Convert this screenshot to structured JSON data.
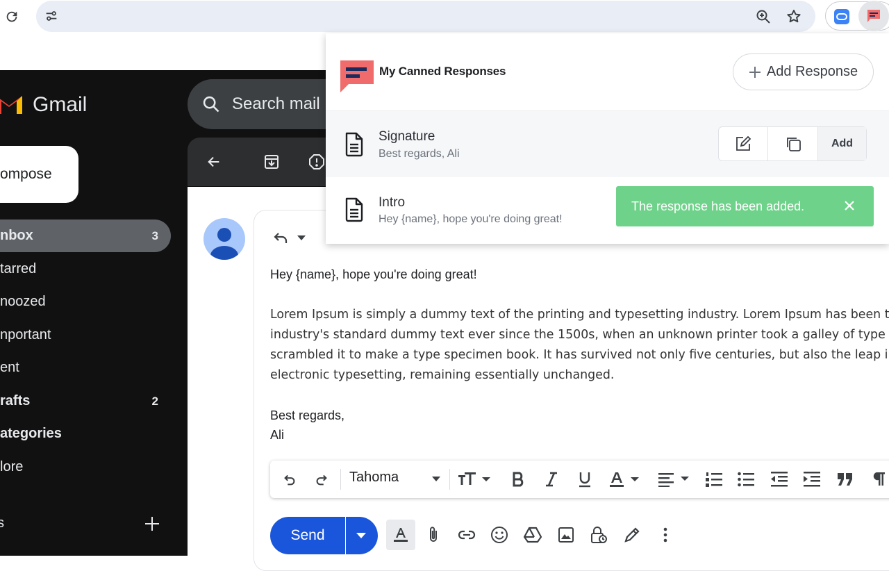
{
  "browser": {
    "icons": [
      "reload-icon",
      "site-settings-icon",
      "zoom-icon",
      "bookmark-star-icon",
      "extension-icon",
      "canned-responses-extension-icon"
    ]
  },
  "gmail": {
    "logo_text": "Gmail",
    "search_placeholder": "Search mail",
    "compose_label": "ompose",
    "nav": [
      {
        "label": "nbox",
        "count": "3",
        "active": true,
        "bold": true
      },
      {
        "label": "tarred",
        "count": "",
        "active": false,
        "bold": false
      },
      {
        "label": "noozed",
        "count": "",
        "active": false,
        "bold": false
      },
      {
        "label": "nportant",
        "count": "",
        "active": false,
        "bold": false
      },
      {
        "label": "ent",
        "count": "",
        "active": false,
        "bold": false
      },
      {
        "label": "rafts",
        "count": "2",
        "active": false,
        "bold": true
      },
      {
        "label": "ategories",
        "count": "",
        "active": false,
        "bold": true
      },
      {
        "label": "lore",
        "count": "",
        "active": false,
        "bold": false
      }
    ],
    "labels_header": "s"
  },
  "email": {
    "greeting": "Hey {name}, hope you're doing great!",
    "paragraph_lines": [
      "Lorem Ipsum is simply a dummy text of the printing and typesetting industry. Lorem Ipsum has been the",
      "industry's standard dummy text ever since the 1500s, when an unknown printer took a galley of type and",
      "scrambled it to make a type specimen book. It has survived not only five centuries, but also the leap into",
      "electronic typesetting, remaining essentially unchanged."
    ],
    "signoff": "Best regards,",
    "name": "Ali",
    "font_name": "Tahoma",
    "send_label": "Send"
  },
  "popup": {
    "title": "My Canned Responses",
    "add_button_label": "Add Response",
    "responses": [
      {
        "title": "Signature",
        "preview": "Best regards, Ali",
        "add_label": "Add"
      },
      {
        "title": "Intro",
        "preview": "Hey {name}, hope you're doing great!"
      }
    ],
    "toast": "The response has been added.",
    "brand_color": "#f06b6b"
  }
}
